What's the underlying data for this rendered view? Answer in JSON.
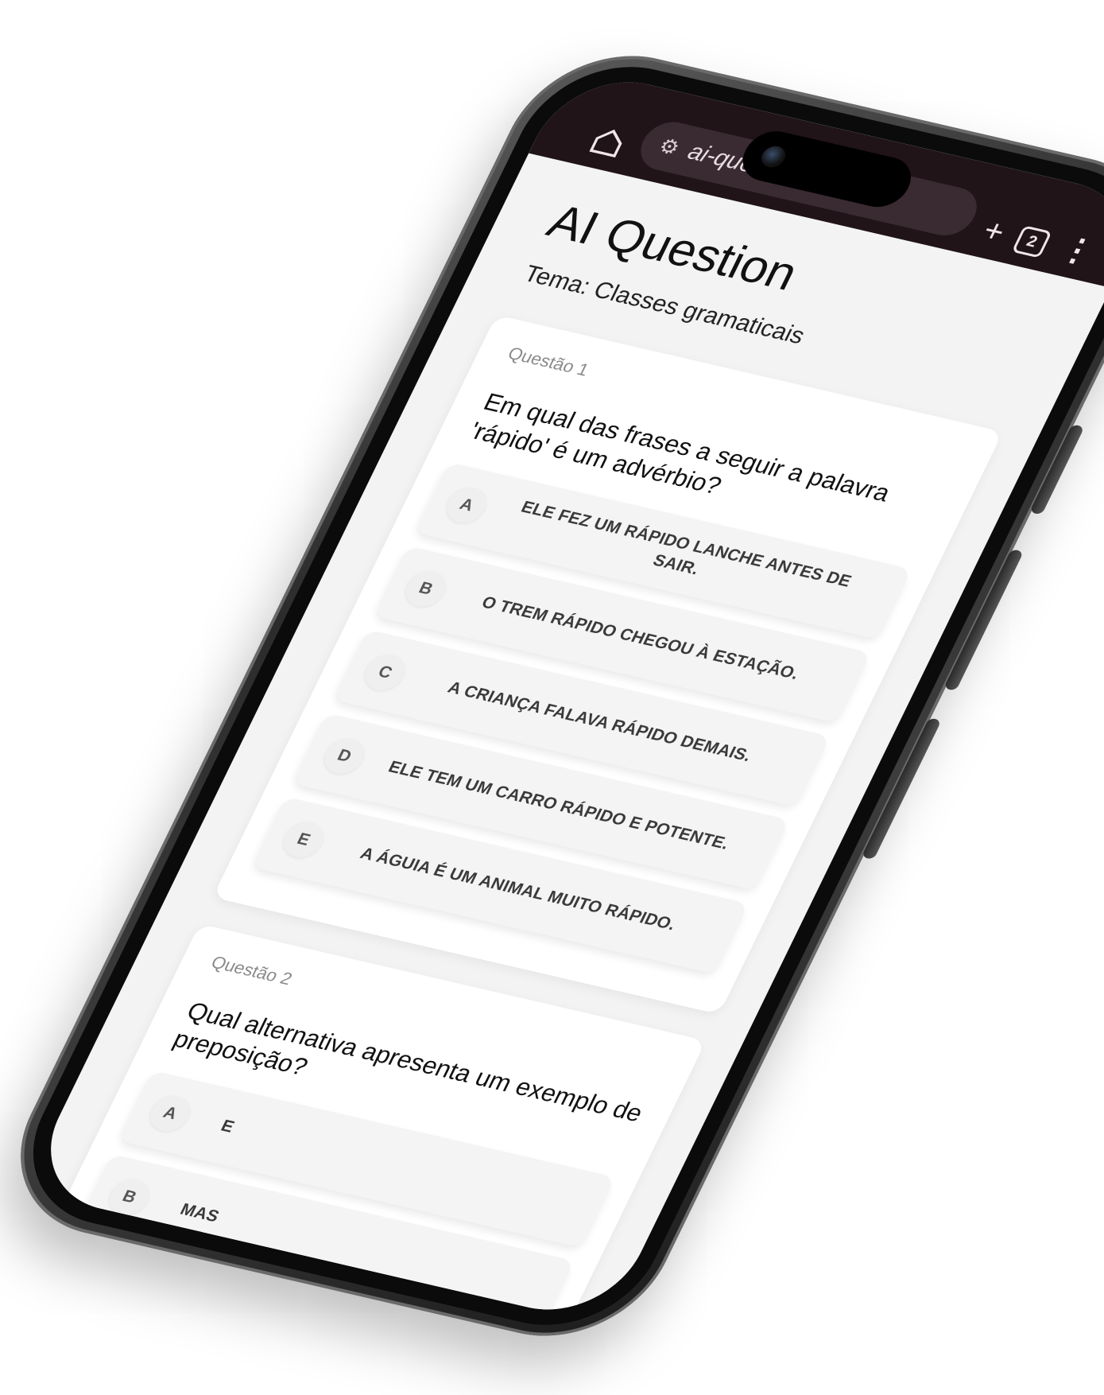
{
  "browser": {
    "url": "ai-quest",
    "tab_count": "2"
  },
  "page": {
    "title": "AI Question",
    "theme": "Tema: Classes gramaticais"
  },
  "questions": [
    {
      "label": "Questão 1",
      "text": "Em qual das frases a seguir a palavra 'rápido' é um advérbio?",
      "options": [
        {
          "letter": "A",
          "text": "ELE FEZ UM RÁPIDO LANCHE ANTES DE SAIR."
        },
        {
          "letter": "B",
          "text": "O TREM RÁPIDO CHEGOU À ESTAÇÃO."
        },
        {
          "letter": "C",
          "text": "A CRIANÇA FALAVA RÁPIDO DEMAIS."
        },
        {
          "letter": "D",
          "text": "ELE TEM UM CARRO RÁPIDO E POTENTE."
        },
        {
          "letter": "E",
          "text": "A ÁGUIA É UM ANIMAL MUITO RÁPIDO."
        }
      ]
    },
    {
      "label": "Questão 2",
      "text": "Qual alternativa apresenta um exemplo de preposição?",
      "options": [
        {
          "letter": "A",
          "text": "E"
        },
        {
          "letter": "B",
          "text": "MAS"
        }
      ]
    }
  ]
}
